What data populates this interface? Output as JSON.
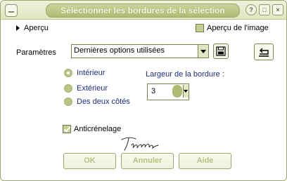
{
  "window": {
    "title": "Sélectionner les bordures de la sélection"
  },
  "preview": {
    "label": "Aperçu",
    "image_preview_label": "Aperçu de l'image",
    "image_preview_checked": true
  },
  "settings": {
    "label": "Paramètres",
    "preset": "Dernières options utilisées"
  },
  "border_side": {
    "options": [
      "Intérieur",
      "Extérieur",
      "Des deux côtés"
    ],
    "selected": "Intérieur"
  },
  "border_width": {
    "label": "Largeur de la bordure :",
    "value": "3"
  },
  "antialias": {
    "label": "Anticrénelage",
    "checked": true
  },
  "signature": "Titoune",
  "buttons": {
    "ok": "OK",
    "cancel": "Annuler",
    "help": "Aide"
  },
  "colors": {
    "accent": "#aebc73",
    "radio_label": "#1a2c8c",
    "button_text": "#b6c27e"
  },
  "icons": {
    "save": "floppy-disk-icon",
    "reset": "reset-defaults-icon",
    "spin": "spinner-icon"
  }
}
